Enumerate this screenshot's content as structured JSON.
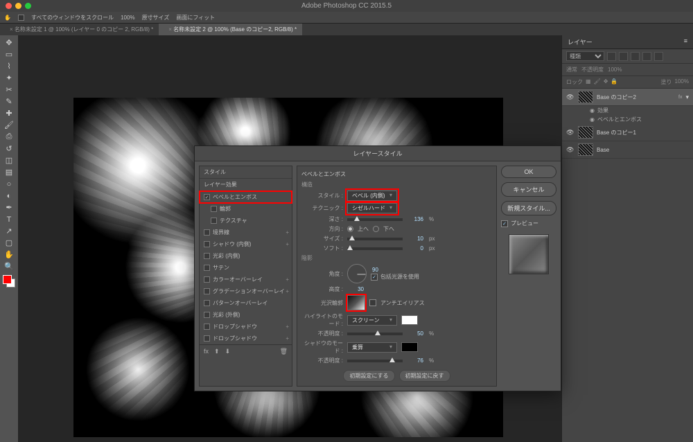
{
  "app": {
    "title": "Adobe Photoshop CC 2015.5"
  },
  "optbar": {
    "scroll_all": "すべてのウィンドウをスクロール",
    "zoom": "100%",
    "actual": "原寸サイズ",
    "fit": "画面にフィット"
  },
  "tabs": {
    "t1": "名称未設定 1 @ 100% (レイヤー 0 のコピー 2, RGB/8) *",
    "t2": "名称未設定 2 @ 100% (Base のコピー2, RGB/8) *"
  },
  "layersPanel": {
    "title": "レイヤー",
    "filter_kind": "種類",
    "blend": "通常",
    "opacity_label": "不透明度",
    "opacity": "100%",
    "lock": "ロック",
    "fill_label": "塗り",
    "fill": "100%",
    "l1": "Base のコピー2",
    "fx": "fx",
    "eff_h": "効果",
    "eff_bevel": "ベベルとエンボス",
    "l2": "Base のコピー1",
    "l3": "Base"
  },
  "dialog": {
    "title": "レイヤースタイル",
    "left": {
      "styles": "スタイル",
      "blend_opts": "レイヤー効果",
      "bevel": "ベベルとエンボス",
      "contour": "輪郭",
      "texture": "テクスチャ",
      "stroke": "境界線",
      "inner_shadow": "シャドウ (内側)",
      "inner_glow": "光彩 (内側)",
      "satin": "サテン",
      "color_overlay": "カラーオーバーレイ",
      "grad_overlay": "グラデーションオーバーレイ",
      "pat_overlay": "パターンオーバーレイ",
      "outer_glow": "光彩 (外側)",
      "drop_shadow": "ドロップシャドウ",
      "drop_shadow2": "ドロップシャドウ"
    },
    "mid": {
      "h": "ベベルとエンボス",
      "structure": "構造",
      "style_l": "スタイル :",
      "style_v": "ベベル (内側)",
      "tech_l": "テクニック :",
      "tech_v": "シゼルハード",
      "depth_l": "深さ :",
      "depth_v": "136",
      "dir_l": "方向 :",
      "dir_up": "上へ",
      "dir_down": "下へ",
      "size_l": "サイズ :",
      "size_v": "10",
      "px": "px",
      "soft_l": "ソフト :",
      "soft_v": "0",
      "shading": "陰影",
      "angle_l": "角度 :",
      "angle_v": "90",
      "global": "包括光源を使用",
      "alt_l": "高度 :",
      "alt_v": "30",
      "gloss_l": "光沢輪郭",
      "aa": "アンチエイリアス",
      "hi_mode_l": "ハイライトのモード :",
      "hi_mode_v": "スクリーン",
      "hi_op_l": "不透明度 :",
      "hi_op_v": "50",
      "sh_mode_l": "シャドウのモード :",
      "sh_mode_v": "乗算",
      "sh_op_l": "不透明度 :",
      "sh_op_v": "76",
      "pct": "%",
      "make_default": "初期設定にする",
      "reset_default": "初期設定に戻す"
    },
    "right": {
      "ok": "OK",
      "cancel": "キャンセル",
      "new_style": "新規スタイル...",
      "preview": "プレビュー"
    }
  }
}
